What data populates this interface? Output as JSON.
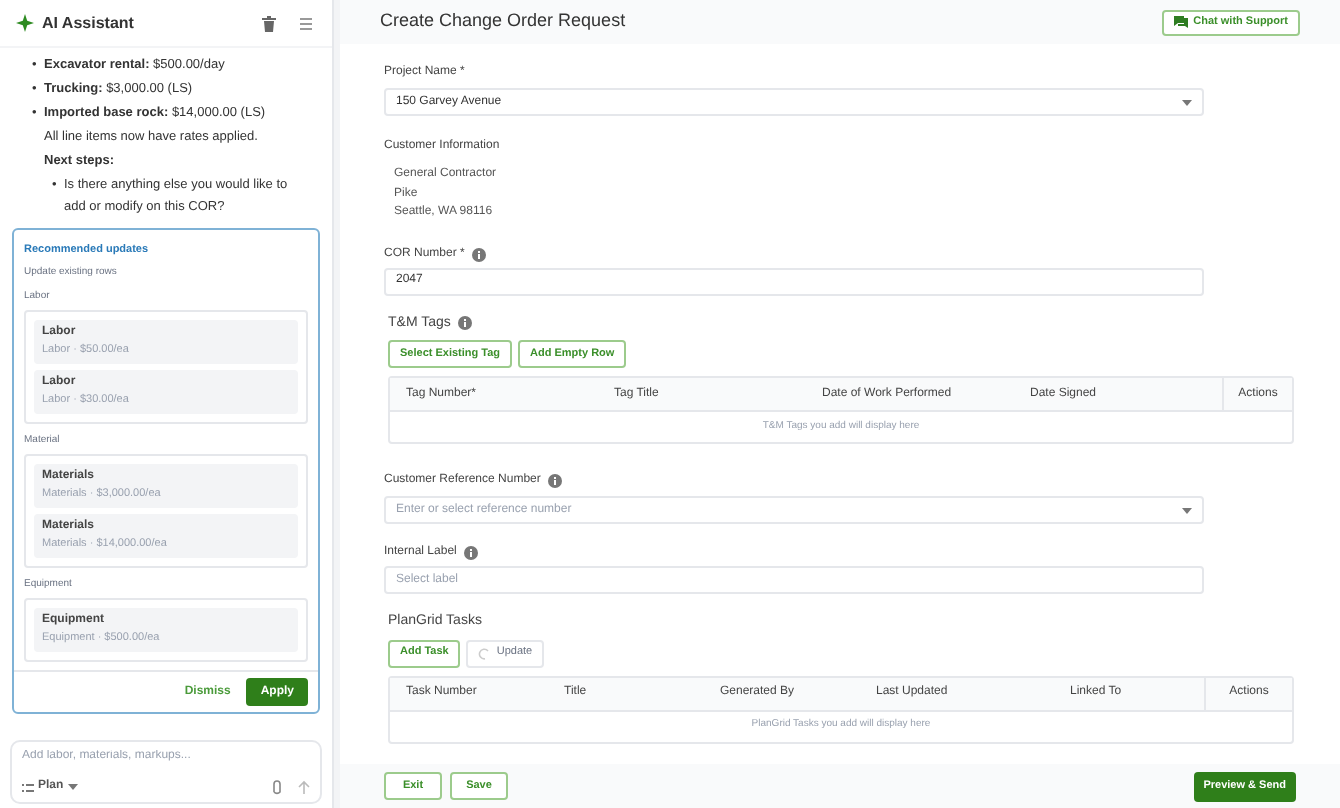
{
  "assistant": {
    "title": "AI Assistant",
    "bullet": "•",
    "rates": [
      {
        "label": "Excavator rental:",
        "value": "$500.00/day"
      },
      {
        "label": "Trucking:",
        "value": "$3,000.00 (LS)"
      },
      {
        "label": "Imported base rock:",
        "value": "$14,000.00 (LS)"
      }
    ],
    "note": "All line items now have rates applied.",
    "next_heading": "Next steps:",
    "next_items": [
      "Is there anything else you would like to add or modify on this COR?"
    ],
    "recommended": {
      "title": "Recommended updates",
      "subtitle": "Update existing rows",
      "groups": [
        {
          "name": "Labor",
          "items": [
            {
              "title": "Labor",
              "detail": "Labor · $50.00/ea"
            },
            {
              "title": "Labor",
              "detail": "Labor · $30.00/ea"
            }
          ]
        },
        {
          "name": "Material",
          "items": [
            {
              "title": "Materials",
              "detail": "Materials · $3,000.00/ea"
            },
            {
              "title": "Materials",
              "detail": "Materials · $14,000.00/ea"
            }
          ]
        },
        {
          "name": "Equipment",
          "items": [
            {
              "title": "Equipment",
              "detail": "Equipment · $500.00/ea"
            }
          ]
        }
      ],
      "dismiss": "Dismiss",
      "apply": "Apply"
    },
    "composer": {
      "placeholder": "Add labor, materials, markups...",
      "mode": "Plan"
    }
  },
  "form": {
    "title": "Create Change Order Request",
    "chat_button": "Chat with Support",
    "project": {
      "label": "Project Name *",
      "value": "150 Garvey Avenue"
    },
    "customer": {
      "label": "Customer Information",
      "lines": [
        "General Contractor",
        "Pike",
        "Seattle, WA 98116"
      ]
    },
    "cor": {
      "label": "COR Number *",
      "value": "2047"
    },
    "tm_tags": {
      "title": "T&M Tags",
      "buttons": [
        "Select Existing Tag",
        "Add Empty Row"
      ],
      "columns": [
        "Tag Number*",
        "Tag Title",
        "Date of Work Performed",
        "Date Signed",
        "Actions"
      ],
      "empty": "T&M Tags you add will display here"
    },
    "reference": {
      "label": "Customer Reference Number",
      "placeholder": "Enter or select reference number"
    },
    "internal_label": {
      "label": "Internal Label",
      "placeholder": "Select label"
    },
    "tasks": {
      "title": "PlanGrid Tasks",
      "add": "Add Task",
      "update": {
        "label": "Update",
        "disabled": true
      },
      "columns": [
        "Task Number",
        "Title",
        "Generated By",
        "Last Updated",
        "Linked To",
        "Actions"
      ],
      "empty": "PlanGrid Tasks you add will display here"
    },
    "footer": {
      "exit": "Exit",
      "save": "Save",
      "send": "Preview & Send"
    }
  }
}
